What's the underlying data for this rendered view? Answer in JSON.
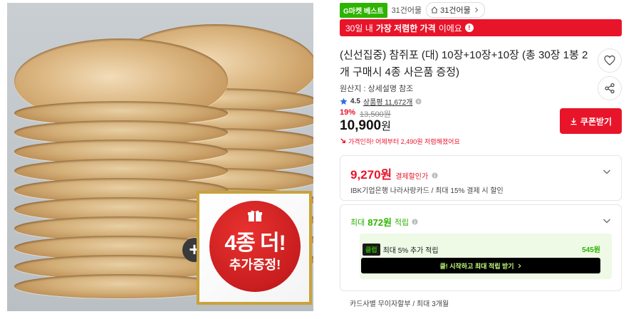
{
  "image": {
    "promo_line1": "4종 더!",
    "promo_line2": "추가증정!",
    "plus_symbol": "+"
  },
  "header": {
    "gmarket_badge": "G마켓 베스트",
    "sales_count": "31건어물",
    "store_name": "31건어물"
  },
  "price_banner": {
    "prefix": "30일 내 ",
    "highlight": "가장 저렴한 가격",
    "suffix": "이에요"
  },
  "product": {
    "title": "(신선집중) 참쥐포 (대) 10장+10장+10장 (총 30장 1봉 2개 구매시 4종 사은품 증정)",
    "origin": "원산지 : 상세설명 참조",
    "rating": "4.5",
    "review_label": "상품평 11,672개",
    "discount_rate": "19%",
    "original_price": "13,500원",
    "sale_price_number": "10,900",
    "sale_price_unit": "원",
    "price_drop_note": "가격인하! 어제부터 2,490원 저렴해졌어요"
  },
  "coupon": {
    "label": "쿠폰받기"
  },
  "card_discount": {
    "price": "9,270원",
    "label": "결제할인가",
    "description": "IBK기업은행 나라사랑카드 / 최대 15% 결제 시 할인"
  },
  "points": {
    "prefix": "최대",
    "amount": "872원",
    "suffix": "적립",
    "membership_tag": "클럽",
    "membership_label": "최대 5% 추가 적립",
    "membership_amount": "545원",
    "membership_button": "클! 시작하고 최대 적립 받기"
  },
  "installment": {
    "text": "카드사별 무이자할부 / 최대 3개월"
  },
  "colors": {
    "accent_red": "#e8142a",
    "accent_green": "#2db400",
    "text_dark": "#222222"
  }
}
